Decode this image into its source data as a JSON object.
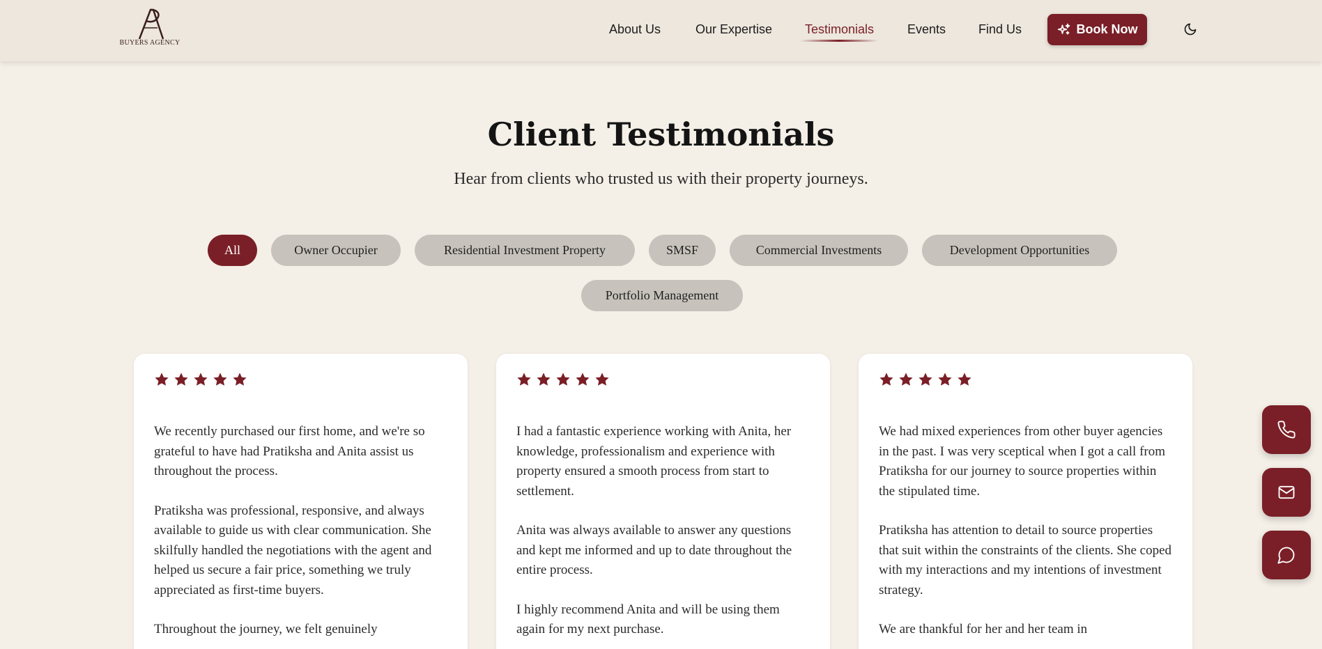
{
  "header": {
    "logo_text": "BUYERS AGENCY",
    "logo_mark": "AP",
    "nav": [
      "About Us",
      "Our Expertise",
      "Testimonials",
      "Events",
      "Find Us"
    ],
    "active_nav": "Testimonials",
    "book_label": "Book Now"
  },
  "hero": {
    "title": "Client Testimonials",
    "subtitle": "Hear from clients who trusted us with their property journeys."
  },
  "filters": {
    "items": [
      "All",
      "Owner Occupier",
      "Residential Investment Property",
      "SMSF",
      "Commercial Investments",
      "Development Opportunities",
      "Portfolio Management"
    ],
    "active": "All"
  },
  "testimonials": [
    {
      "rating": 5,
      "paragraphs": [
        "We recently purchased our first home, and we're so grateful to have had Pratiksha and Anita assist us throughout the process.",
        "Pratiksha was professional, responsive, and always available to guide us with clear communication. She skilfully handled the negotiations with the agent and helped us secure a fair price, something we truly appreciated as first-time buyers.",
        "Throughout the journey, we felt genuinely"
      ]
    },
    {
      "rating": 5,
      "paragraphs": [
        "I had a fantastic experience working with Anita, her knowledge, professionalism and experience with property ensured a smooth process from start to settlement.",
        "Anita was always available to answer any questions and kept me informed and up to date throughout the entire process.",
        "I highly recommend Anita and will be using them again for my next purchase."
      ]
    },
    {
      "rating": 5,
      "paragraphs": [
        "We had mixed experiences from other buyer agencies in the past. I was very sceptical when I got a call from Pratiksha for our journey to source properties within the stipulated time.",
        "Pratiksha has attention to detail to source properties that suit within the constraints of the clients. She coped with my interactions and my intentions of investment strategy.",
        "We are thankful for her and her team in"
      ]
    }
  ],
  "fabs": [
    "phone-icon",
    "mail-icon",
    "chat-icon"
  ],
  "colors": {
    "accent": "#7a1f27",
    "background": "#f4efe7",
    "header": "#ede7dd",
    "chip": "#c7c3bc"
  }
}
